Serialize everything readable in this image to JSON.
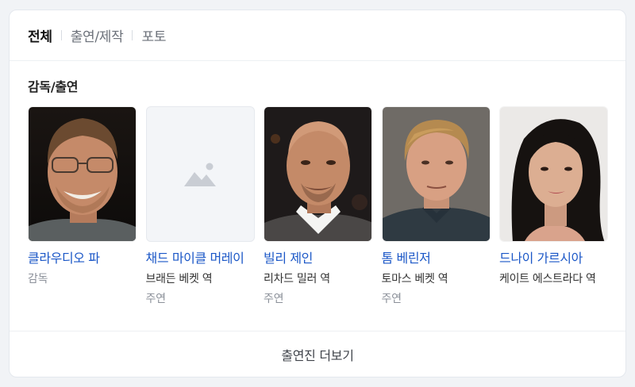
{
  "tabs": [
    {
      "label": "전체",
      "active": true
    },
    {
      "label": "출연/제작",
      "active": false
    },
    {
      "label": "포토",
      "active": false
    }
  ],
  "section_title": "감독/출연",
  "people": [
    {
      "name": "클라우디오 파",
      "role": "감독",
      "sub": "",
      "photo": "photo-man-smiling-glasses"
    },
    {
      "name": "채드 마이클 머레이",
      "role": "브래든 베켓 역",
      "sub": "주연",
      "photo": "image-placeholder-icon"
    },
    {
      "name": "빌리 제인",
      "role": "리차드 밀러 역",
      "sub": "주연",
      "photo": "photo-bald-man"
    },
    {
      "name": "톰 베린저",
      "role": "토마스 베켓 역",
      "sub": "주연",
      "photo": "photo-older-man"
    },
    {
      "name": "드나이 가르시아",
      "role": "케이트 에스트라다 역",
      "sub": "",
      "photo": "photo-woman-dark-hair"
    }
  ],
  "more_label": "출연진 더보기"
}
